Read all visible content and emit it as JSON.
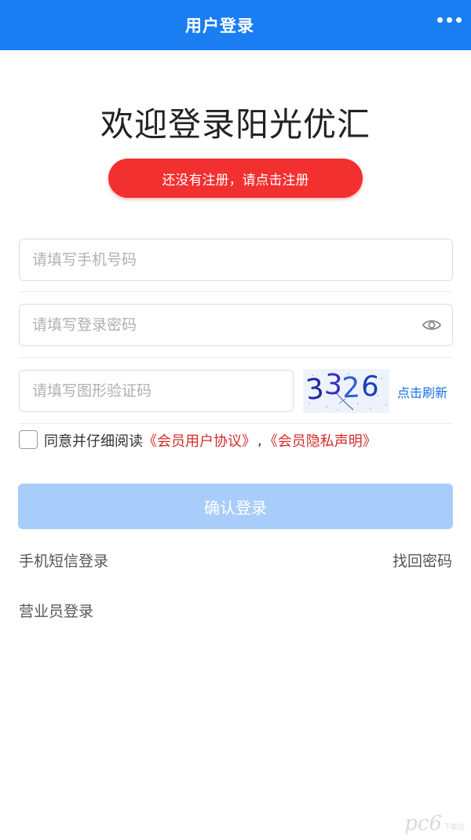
{
  "header": {
    "title": "用户登录",
    "more_icon": "more-dots-icon",
    "background": "#1a7ef2"
  },
  "welcome": "欢迎登录阳光优汇",
  "register_button": {
    "label": "还没有注册，请点击注册",
    "color": "#f23030"
  },
  "form": {
    "phone_placeholder": "请填写手机号码",
    "password_placeholder": "请填写登录密码",
    "captcha_placeholder": "请填写图形验证码",
    "captcha_code": "3326",
    "refresh_label": "点击刷新",
    "password_toggle_icon": "eye-icon"
  },
  "agreement": {
    "prefix": "同意并仔细阅读",
    "user_agreement": "《会员用户协议》",
    "separator": ",",
    "privacy": "《会员隐私声明》",
    "checked": false
  },
  "login_button": {
    "label": "确认登录",
    "color": "#a8cdfa"
  },
  "links": {
    "sms_login": "手机短信登录",
    "find_password": "找回密码",
    "staff_login": "营业员登录"
  },
  "watermark": {
    "logo": "pc6",
    "sub": "下载站"
  }
}
